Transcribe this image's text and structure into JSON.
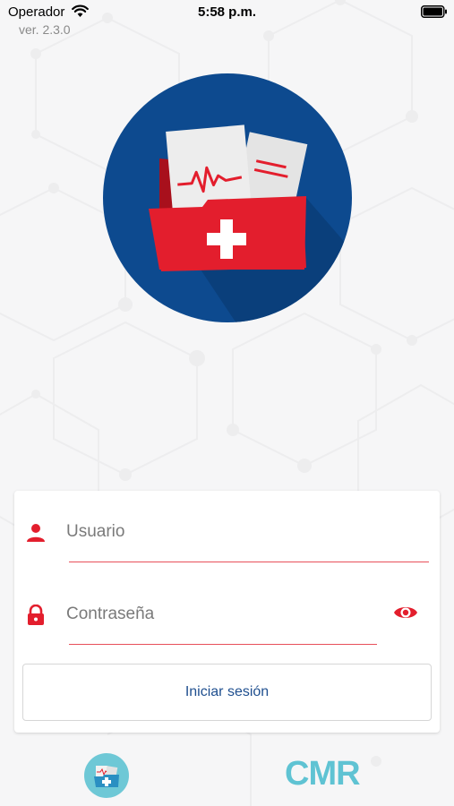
{
  "status_bar": {
    "carrier": "Operador",
    "time": "5:58 p.m.",
    "wifi_icon": "wifi-icon",
    "battery_icon": "battery-icon"
  },
  "app": {
    "version": "ver. 2.3.0",
    "logo_icon": "medical-folder-icon",
    "colors": {
      "primary_blue": "#0d4a8f",
      "accent_red": "#e31e2d",
      "brand_teal": "#5fc3d3"
    }
  },
  "login": {
    "username": {
      "icon": "user-icon",
      "placeholder": "Usuario",
      "value": ""
    },
    "password": {
      "icon": "lock-icon",
      "placeholder": "Contraseña",
      "value": "",
      "toggle_icon": "eye-icon"
    },
    "submit_label": "Iniciar sesión"
  },
  "footer": {
    "app_icon": "medical-folder-icon",
    "brand": "CMR"
  }
}
